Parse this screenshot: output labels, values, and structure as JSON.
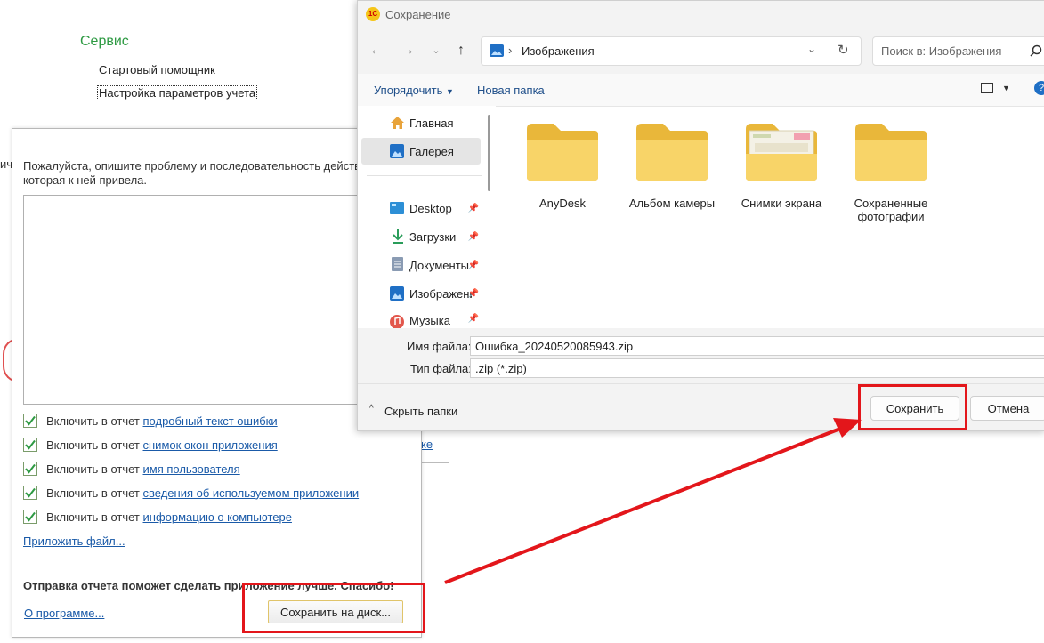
{
  "background": {
    "service_title": "Сервис",
    "items": [
      "Стартовый помощник",
      "Настройка параметров учета"
    ],
    "side_fragment": "ич",
    "link_fragment": "ке"
  },
  "report": {
    "description": "Пожалуйста, опишите проблему и последовательность действий, которая к ней привела.",
    "include_prefix": "Включить в отчет",
    "checks": [
      {
        "link": "подробный текст ошибки",
        "checked": true
      },
      {
        "link": "снимок окон приложения",
        "checked": true
      },
      {
        "link": "имя пользователя",
        "checked": true
      },
      {
        "link": "сведения об используемом приложении",
        "checked": true
      },
      {
        "link": "информацию о компьютере",
        "checked": true
      }
    ],
    "attach_link": "Приложить файл...",
    "footer_text": "Отправка отчета поможет сделать приложение лучше. Спасибо!",
    "about_link": "О программе...",
    "save_disk_label": "Сохранить на диск..."
  },
  "dialog": {
    "title": "Сохранение",
    "app_icon_text": "1С",
    "path": "Изображения",
    "search_placeholder": "Поиск в: Изображения",
    "toolbar": {
      "organize": "Упорядочить",
      "new_folder": "Новая папка"
    },
    "sidebar": [
      {
        "label": "Главная",
        "icon": "home-icon",
        "pinned": false,
        "selected": false
      },
      {
        "label": "Галерея",
        "icon": "gallery-icon",
        "pinned": false,
        "selected": true
      },
      {
        "label": "Desktop",
        "icon": "desktop-icon",
        "pinned": true,
        "selected": false
      },
      {
        "label": "Загрузки",
        "icon": "downloads-icon",
        "pinned": true,
        "selected": false
      },
      {
        "label": "Документы",
        "icon": "documents-icon",
        "pinned": true,
        "selected": false
      },
      {
        "label": "Изображения",
        "icon": "pictures-icon",
        "pinned": true,
        "selected": false
      },
      {
        "label": "Музыка",
        "icon": "music-icon",
        "pinned": true,
        "selected": false
      }
    ],
    "folders": [
      {
        "name": "AnyDesk"
      },
      {
        "name": "Альбом камеры"
      },
      {
        "name": "Снимки экрана"
      },
      {
        "name": "Сохраненные фотографии"
      }
    ],
    "filename_label": "Имя файла:",
    "filename_value": "Ошибка_20240520085943.zip",
    "filetype_label": "Тип файла:",
    "filetype_value": ".zip (*.zip)",
    "hide_folders": "Скрыть папки",
    "save_label": "Сохранить",
    "cancel_label": "Отмена"
  },
  "colors": {
    "annotation": "#e3161b",
    "service_title": "#2e9a43",
    "link": "#1a5aa8",
    "folder": "#f5c842"
  }
}
